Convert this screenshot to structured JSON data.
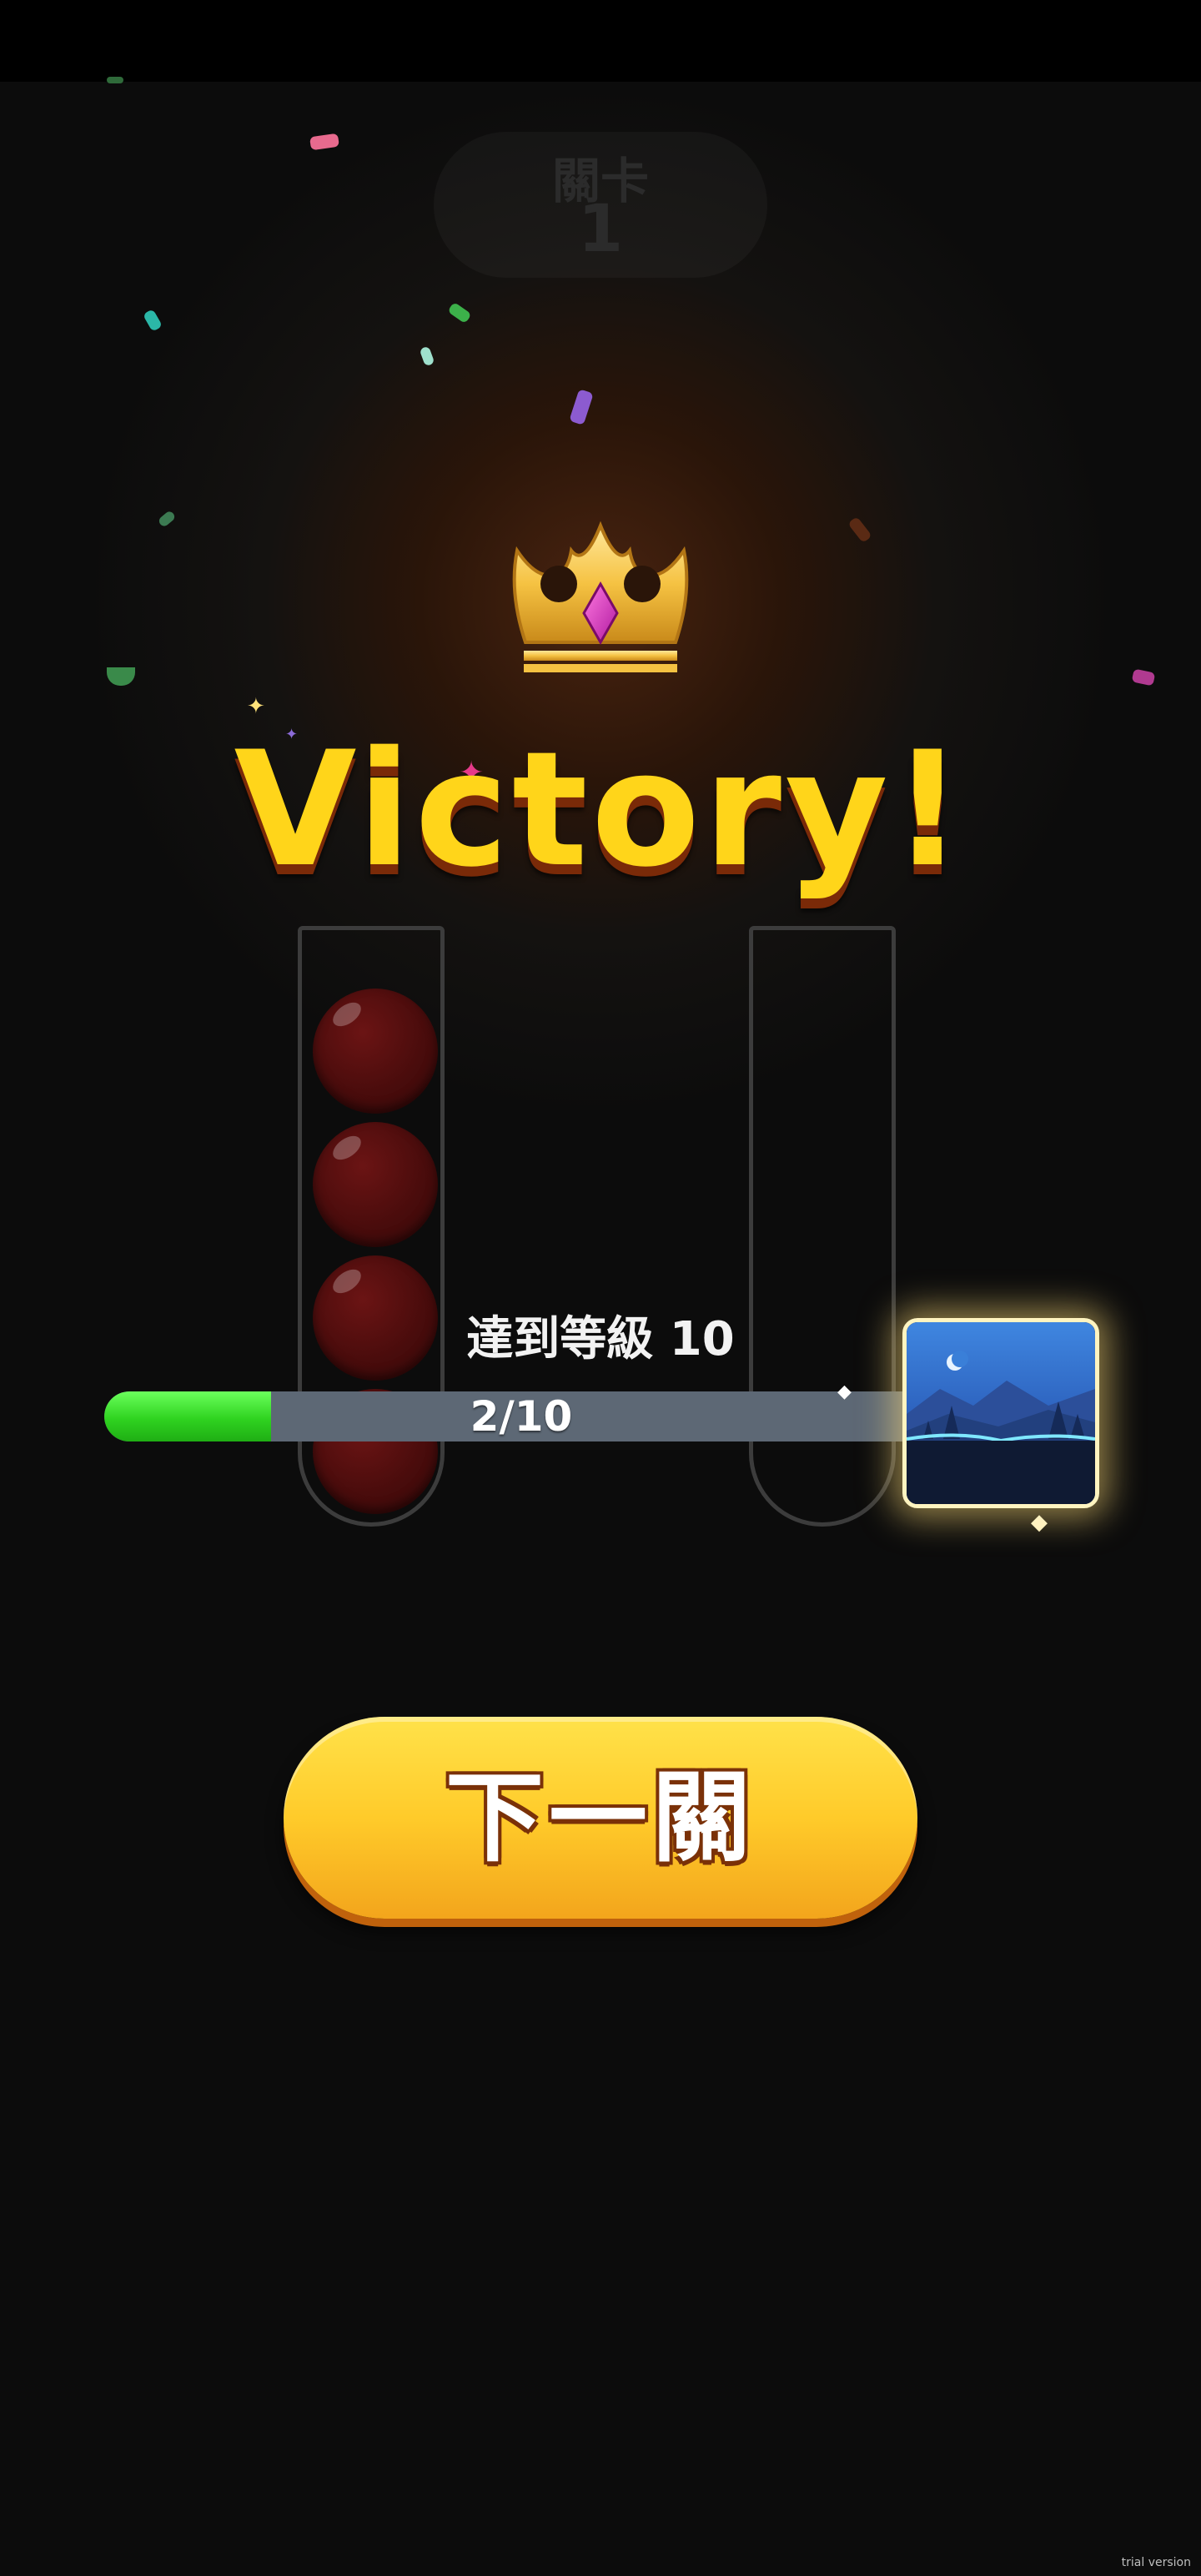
{
  "level": {
    "label": "關卡",
    "number": "1"
  },
  "result": {
    "title": "Victory!"
  },
  "icons": {
    "crown": "crown-icon",
    "reward": "night-landscape-reward-icon"
  },
  "tubes": [
    {
      "ball_count": 4,
      "ball_color": "#4a0c0c"
    },
    {
      "ball_count": 0,
      "ball_color": ""
    }
  ],
  "progress": {
    "reach_text": "達到等級 10",
    "text": "2/10",
    "current": 2,
    "total": 10
  },
  "next_button": {
    "label": "下一關"
  },
  "watermark": "trial version",
  "colors": {
    "accent_yellow": "#ffd51a",
    "progress_green": "#2fd320",
    "button_orange": "#ffcb2a"
  }
}
